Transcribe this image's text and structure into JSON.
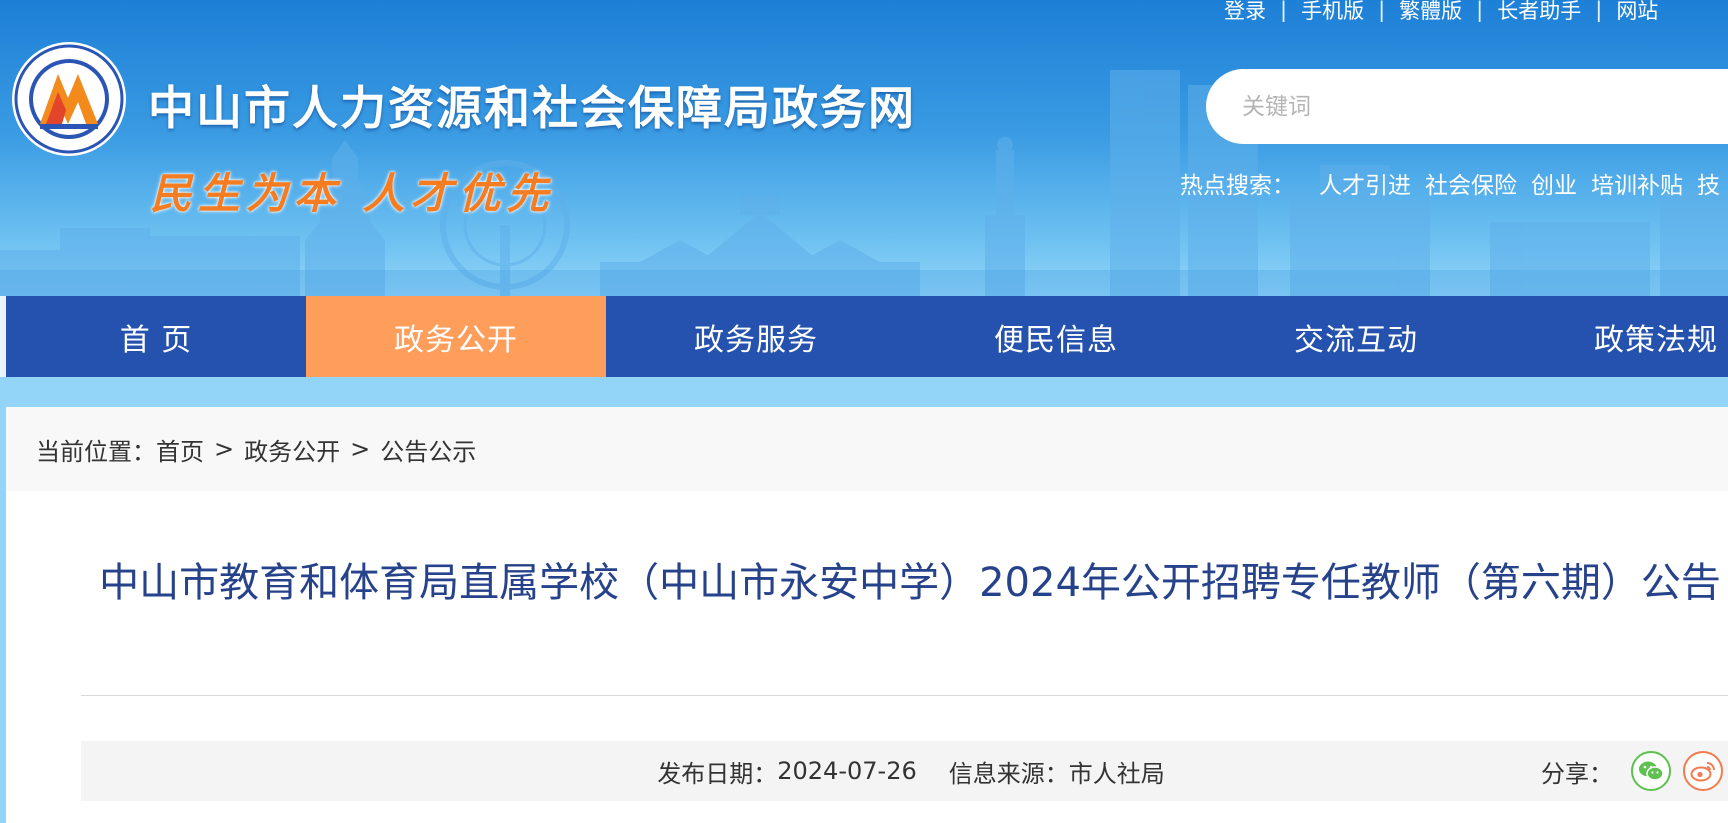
{
  "header": {
    "top_links": [
      "登录",
      "手机版",
      "繁體版",
      "长者助手",
      "网站"
    ],
    "site_title": "中山市人力资源和社会保障局政务网",
    "slogan": "民生为本 人才优先",
    "logo_icon": "hrss-emblem-icon",
    "search": {
      "placeholder": "关键词"
    },
    "hot_search": {
      "label": "热点搜索：",
      "items": [
        "人才引进",
        "社会保险",
        "创业",
        "培训补贴",
        "技"
      ]
    }
  },
  "nav": {
    "items": [
      "首 页",
      "政务公开",
      "政务服务",
      "便民信息",
      "交流互动",
      "政策法规"
    ],
    "active_index": 1
  },
  "breadcrumb": {
    "label": "当前位置：",
    "items": [
      "首页",
      "政务公开",
      "公告公示"
    ],
    "separator": ">"
  },
  "article": {
    "title": "中山市教育和体育局直属学校（中山市永安中学）2024年公开招聘专任教师（第六期）公告",
    "publish_date_label": "发布日期：",
    "publish_date": "2024-07-26",
    "source_label": "信息来源：",
    "source": "市人社局",
    "share_label": "分享：",
    "share_icons": [
      "wechat-icon",
      "weibo-icon"
    ]
  },
  "colors": {
    "nav_bg": "#2552ae",
    "nav_active": "#ff9d5b",
    "title_color": "#26428b",
    "slogan_color": "#f57c20",
    "header_blue": "#1d7fd6"
  }
}
